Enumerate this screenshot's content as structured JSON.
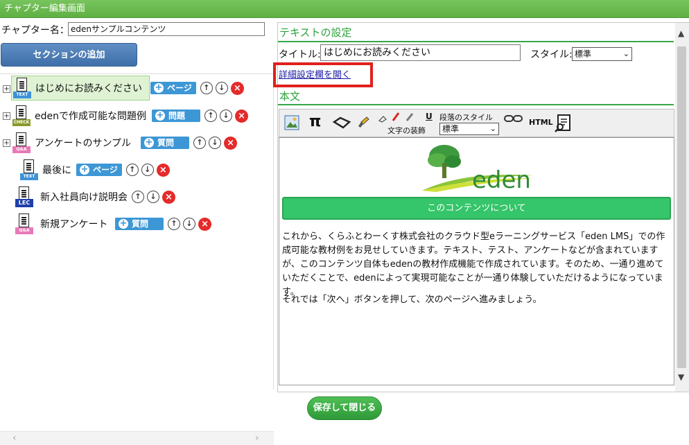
{
  "window": {
    "title": "チャプター編集画面"
  },
  "chapter": {
    "label": "チャプター名：",
    "value": "edenサンプルコンテンツ"
  },
  "add_section_label": "セクションの追加",
  "tree": [
    {
      "label": "はじめにお読みください",
      "icon_tag": "TEXT",
      "badge": "ページ"
    },
    {
      "label": "edenで作成可能な問題例",
      "icon_tag": "CHECK",
      "badge": "問題"
    },
    {
      "label": "アンケートのサンプル",
      "icon_tag": "Q&A",
      "badge": "質問"
    },
    {
      "label": "最後に",
      "icon_tag": "TEXT",
      "badge": "ページ"
    },
    {
      "label": "新入社員向け説明会",
      "icon_tag": "LEC"
    },
    {
      "label": "新規アンケート",
      "icon_tag": "Q&A",
      "badge": "質問"
    }
  ],
  "text_settings": {
    "heading": "テキストの設定",
    "title_label": "タイトル:",
    "title_value": "はじめにお読みください",
    "style_label": "スタイル:",
    "style_value": "標準",
    "detail_link": "詳細設定欄を開く"
  },
  "body_section": {
    "heading": "本文",
    "toolbar": {
      "pi": "π",
      "font_decoration_label": "文字の装飾",
      "underline": "U",
      "paragraph_style_label": "段落のスタイル",
      "paragraph_style_value": "標準",
      "html_label": "HTML"
    },
    "logo_text": "eden",
    "content_button": "このコンテンツについて",
    "paragraph1": "これから、くらふとわーくす株式会社のクラウド型eラーニングサービス「eden LMS」での作成可能な教材例をお見せしていきます。テキスト、テスト、アンケートなどが含まれていますが、このコンテンツ自体もedenの教材作成機能で作成されています。そのため、一通り進めていただくことで、edenによって実現可能なことが一通り体験していただけるようになっています。",
    "paragraph2": "それでは「次へ」ボタンを押して、次のページへ進みましょう。"
  },
  "save_button": "保存して閉じる",
  "colors": {
    "titlebar": "#5fb043",
    "accent_green": "#33a845",
    "badge_blue": "#3d97d6",
    "delete_red": "#e52a2a",
    "highlight_red": "#e0201c"
  }
}
